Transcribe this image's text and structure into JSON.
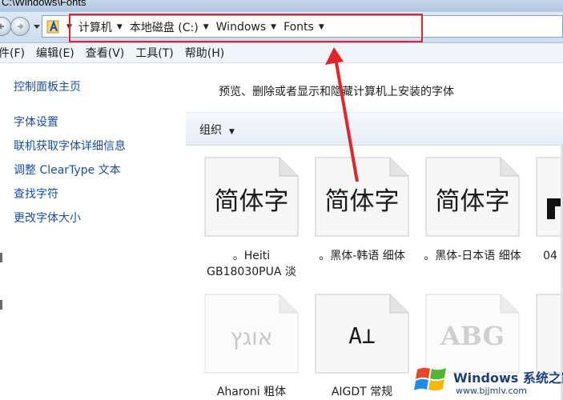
{
  "window": {
    "title": "C:\\Windows\\Fonts"
  },
  "address": {
    "crumbs": [
      {
        "label": "计算机"
      },
      {
        "label": "本地磁盘 (C:)"
      },
      {
        "label": "Windows"
      },
      {
        "label": "Fonts"
      }
    ]
  },
  "menu": {
    "items": [
      {
        "label": "件(F)"
      },
      {
        "label": "编辑(E)"
      },
      {
        "label": "查看(V)"
      },
      {
        "label": "工具(T)"
      },
      {
        "label": "帮助(H)"
      }
    ]
  },
  "sidebar": {
    "home": "控制面板主页",
    "links": [
      {
        "label": "字体设置"
      },
      {
        "label": "联机获取字体详细信息"
      },
      {
        "label": "调整 ClearType 文本"
      },
      {
        "label": "查找字符"
      },
      {
        "label": "更改字体大小"
      }
    ]
  },
  "main": {
    "description": "预览、删除或者显示和隐藏计算机上安装的字体",
    "organize": "组织"
  },
  "fonts": [
    {
      "preview": "简体字",
      "name": "。Heiti GB18030PUA 淡"
    },
    {
      "preview": "简体字",
      "name": "。黑体-韩语 细体"
    },
    {
      "preview": "简体字",
      "name": "。黑体-日本语 细体"
    },
    {
      "preview": "",
      "name": "04"
    },
    {
      "preview": "אוגץ",
      "name": "Aharoni 粗体"
    },
    {
      "preview": "A⊥",
      "name": "AIGDT 常规"
    },
    {
      "preview": "ABG",
      "name": ""
    }
  ],
  "watermark": {
    "title": "Windows 系统之家",
    "url": "www.bjjmlv.com"
  },
  "colors": {
    "annotation": "#e2252b",
    "link": "#1a4ea0"
  }
}
